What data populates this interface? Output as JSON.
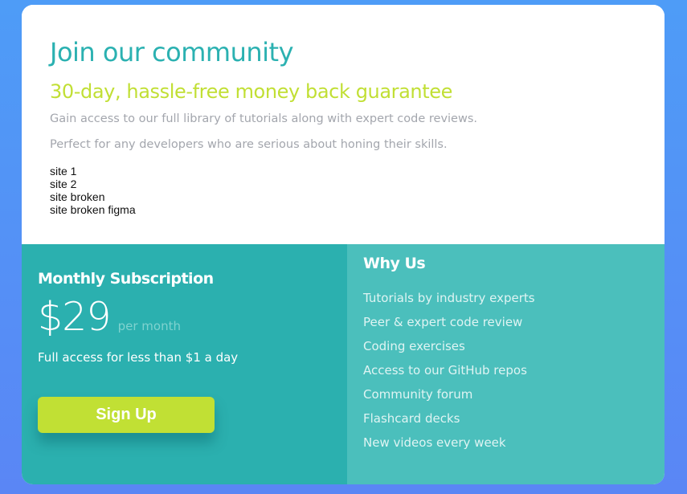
{
  "header": {
    "title": "Join our community",
    "guarantee": "30-day, hassle-free money back guarantee",
    "description_1": "Gain access to our full library of tutorials along with expert code reviews.",
    "description_2": "Perfect for any developers who are serious about honing their skills.",
    "links": [
      "site 1",
      "site 2",
      "site broken",
      "site broken figma"
    ]
  },
  "subscription": {
    "title": "Monthly Subscription",
    "price": "$29",
    "period": "per month",
    "note": "Full access for less than $1 a day",
    "button_label": "Sign Up"
  },
  "why_us": {
    "title": "Why Us",
    "items": [
      "Tutorials by industry experts",
      "Peer & expert code review",
      "Coding exercises",
      "Access to our GitHub repos",
      "Community forum",
      "Flashcard decks",
      "New videos every week"
    ]
  },
  "colors": {
    "background": "#4e9cf7",
    "primary_teal": "#2bb0af",
    "light_teal": "#4bbfbc",
    "accent_lime": "#c1e034",
    "muted_text": "#a3a6ad"
  }
}
